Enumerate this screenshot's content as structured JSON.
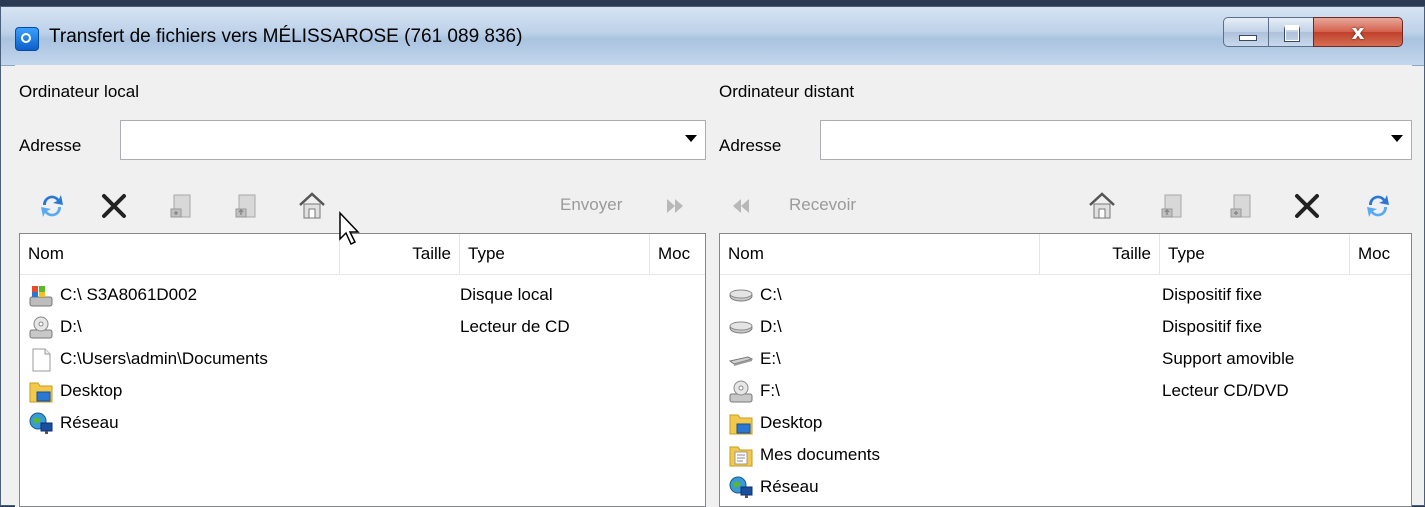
{
  "window": {
    "title": "Transfert de fichiers vers MÉLISSAROSE (761 089 836)",
    "close_glyph": "x"
  },
  "local": {
    "label": "Ordinateur local",
    "address_label": "Adresse",
    "address_value": "",
    "toolbar": {
      "icons": [
        "refresh-icon",
        "delete-icon",
        "new-folder-icon",
        "folder-up-icon",
        "home-icon"
      ],
      "send_label": "Envoyer"
    },
    "columns": [
      "Nom",
      "Taille",
      "Type",
      "Moc"
    ],
    "rows": [
      {
        "icon": "system-drive-icon",
        "name": "C:\\  S3A8061D002",
        "type": "Disque local"
      },
      {
        "icon": "cd-drive-icon",
        "name": "D:\\",
        "type": "Lecteur de CD"
      },
      {
        "icon": "document-icon",
        "name": "C:\\Users\\admin\\Documents",
        "type": ""
      },
      {
        "icon": "desktop-folder-icon",
        "name": "Desktop",
        "type": ""
      },
      {
        "icon": "network-icon",
        "name": "Réseau",
        "type": ""
      }
    ]
  },
  "remote": {
    "label": "Ordinateur distant",
    "address_label": "Adresse",
    "address_value": "",
    "toolbar": {
      "icons": [
        "home-icon",
        "folder-up-icon",
        "new-folder-icon",
        "delete-icon",
        "refresh-icon"
      ],
      "receive_label": "Recevoir"
    },
    "columns": [
      "Nom",
      "Taille",
      "Type",
      "Moc"
    ],
    "rows": [
      {
        "icon": "hard-drive-icon",
        "name": "C:\\",
        "type": "Dispositif fixe"
      },
      {
        "icon": "hard-drive-icon",
        "name": "D:\\",
        "type": "Dispositif fixe"
      },
      {
        "icon": "removable-drive-icon",
        "name": "E:\\",
        "type": "Support amovible"
      },
      {
        "icon": "cd-drive-icon",
        "name": "F:\\",
        "type": "Lecteur CD/DVD"
      },
      {
        "icon": "desktop-folder-icon",
        "name": "Desktop",
        "type": ""
      },
      {
        "icon": "documents-folder-icon",
        "name": "Mes documents",
        "type": ""
      },
      {
        "icon": "network-icon",
        "name": "Réseau",
        "type": ""
      }
    ]
  },
  "colors": {
    "titlebar": "#bcd1e9",
    "close_button": "#c9503a",
    "refresh_blue": "#2a78d4",
    "disabled_text": "#9a9a9a"
  }
}
